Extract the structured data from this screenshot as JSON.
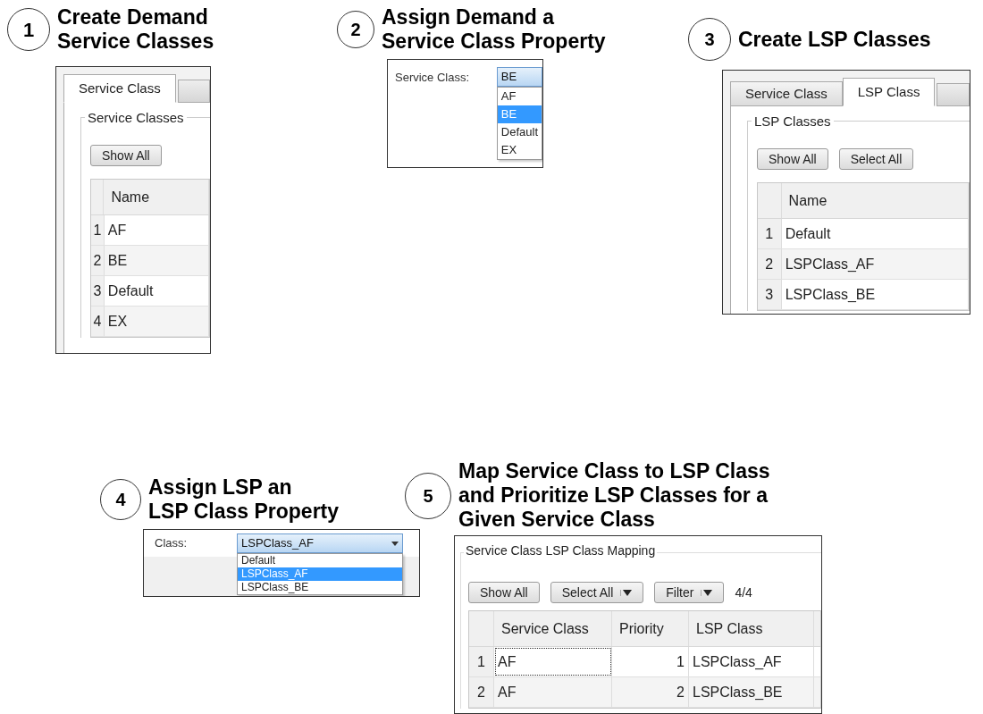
{
  "steps": [
    {
      "number": "1",
      "title": [
        "Create Demand",
        "Service Classes"
      ],
      "kind": "tab_table",
      "tabs": [
        {
          "label": "Service Class",
          "selected": true
        }
      ],
      "group": "Service Classes",
      "buttons": [
        {
          "label": "Show All",
          "dropdown": false
        }
      ],
      "columns": [
        "Name"
      ],
      "rows": [
        {
          "index": "1",
          "cells": [
            "AF"
          ]
        },
        {
          "index": "2",
          "cells": [
            "BE"
          ]
        },
        {
          "index": "3",
          "cells": [
            "Default"
          ]
        },
        {
          "index": "4",
          "cells": [
            "EX"
          ]
        }
      ]
    },
    {
      "number": "2",
      "title": [
        "Assign Demand a",
        "Service Class Property"
      ],
      "kind": "dropdown",
      "label": "Service Class:",
      "value": "BE",
      "options": [
        {
          "label": "AF",
          "selected": false
        },
        {
          "label": "BE",
          "selected": true
        },
        {
          "label": "Default",
          "selected": false
        },
        {
          "label": "EX",
          "selected": false
        }
      ]
    },
    {
      "number": "3",
      "title": [
        "Create LSP Classes"
      ],
      "kind": "tab_table",
      "tabs": [
        {
          "label": "Service Class",
          "selected": false
        },
        {
          "label": "LSP Class",
          "selected": true
        }
      ],
      "group": "LSP Classes",
      "buttons": [
        {
          "label": "Show All",
          "dropdown": false
        },
        {
          "label": "Select All",
          "dropdown": false
        }
      ],
      "columns": [
        "Name"
      ],
      "rows": [
        {
          "index": "1",
          "cells": [
            "Default"
          ]
        },
        {
          "index": "2",
          "cells": [
            "LSPClass_AF"
          ]
        },
        {
          "index": "3",
          "cells": [
            "LSPClass_BE"
          ]
        }
      ]
    },
    {
      "number": "4",
      "title": [
        "Assign LSP an",
        "LSP Class Property"
      ],
      "kind": "dropdown",
      "label": "Class:",
      "value": "LSPClass_AF",
      "options": [
        {
          "label": "Default",
          "selected": false
        },
        {
          "label": "LSPClass_AF",
          "selected": true
        },
        {
          "label": "LSPClass_BE",
          "selected": false
        }
      ]
    },
    {
      "number": "5",
      "title": [
        "Map Service Class to LSP Class",
        "and Prioritize LSP Classes for a",
        "Given Service Class"
      ],
      "kind": "mapping_table",
      "group": "Service Class LSP Class Mapping",
      "buttons": [
        {
          "label": "Show All",
          "dropdown": false
        },
        {
          "label": "Select All",
          "dropdown": true
        },
        {
          "label": "Filter",
          "dropdown": true
        }
      ],
      "count": "4/4",
      "columns": [
        "Service Class",
        "Priority",
        "LSP Class"
      ],
      "rows": [
        {
          "index": "1",
          "cells": [
            "AF",
            "1",
            "LSPClass_AF"
          ],
          "focused": true
        },
        {
          "index": "2",
          "cells": [
            "AF",
            "2",
            "LSPClass_BE"
          ],
          "focused": false
        }
      ]
    }
  ]
}
